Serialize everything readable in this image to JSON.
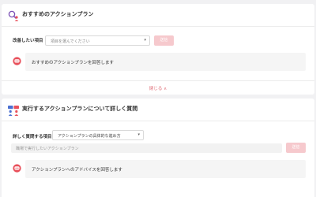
{
  "recommend": {
    "title": "おすすめのアクションプラン",
    "field_label": "改善したい項目",
    "select_placeholder": "項目を選んでください",
    "submit_label": "送信",
    "reply": "おすすめのアクションプランを回答します",
    "toggle_label": "閉じる ∧"
  },
  "detail": {
    "title": "実行するアクションプランについて詳しく質問",
    "field_label": "詳しく質問する項目",
    "select_value": "アクションプランの具体的な進め方",
    "input_placeholder": "職場で実行したいアクションプラン",
    "submit_label": "送信",
    "reply": "アクションプランへのアドバイスを回答します"
  },
  "colors": {
    "accent": "#e0707a",
    "button_disabled": "#f6c9cd",
    "avatar": "#e8505b"
  }
}
